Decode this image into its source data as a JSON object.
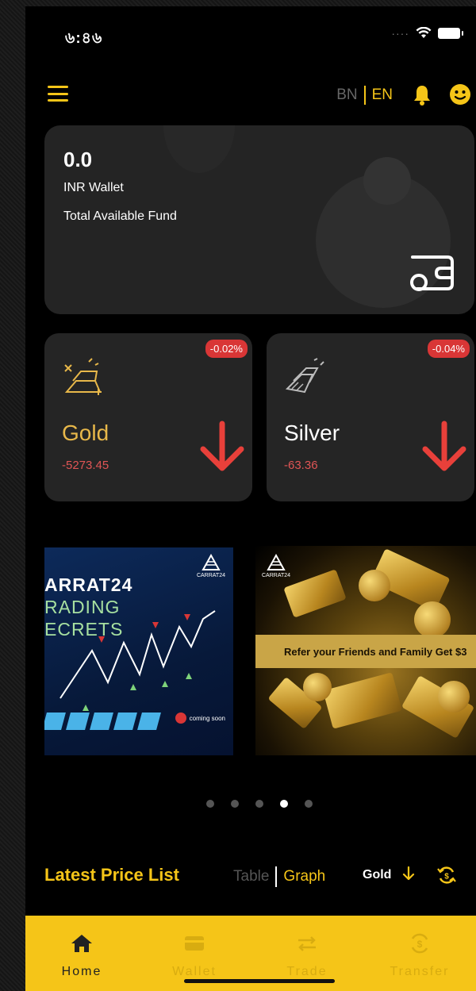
{
  "status_bar": {
    "time": "৬:৪৬"
  },
  "header": {
    "lang_bn": "BN",
    "lang_en": "EN"
  },
  "wallet": {
    "amount": "0.0",
    "currency_label": "INR Wallet",
    "fund_label": "Total Available Fund"
  },
  "metals": [
    {
      "name": "Gold",
      "change": "-5273.45",
      "percent": "-0.02%",
      "direction": "down"
    },
    {
      "name": "Silver",
      "change": "-63.36",
      "percent": "-0.04%",
      "direction": "down"
    }
  ],
  "banners": {
    "left": {
      "title": "ARRAT24",
      "line1": "RADING",
      "line2": "ECRETS",
      "logo": "CARRAT24",
      "coming": "coming soon"
    },
    "right": {
      "logo": "CARRAT24",
      "text": "Refer your Friends and Family Get $3"
    }
  },
  "carousel": {
    "count": 5,
    "active_index": 3
  },
  "price_list": {
    "title": "Latest Price List",
    "toggle_table": "Table",
    "toggle_graph": "Graph",
    "metal": "Gold"
  },
  "bottom_nav": {
    "items": [
      {
        "label": "Home",
        "icon": "home-icon",
        "active": true
      },
      {
        "label": "Wallet",
        "icon": "wallet-icon",
        "active": false
      },
      {
        "label": "Trade",
        "icon": "trade-icon",
        "active": false
      },
      {
        "label": "Transfer",
        "icon": "transfer-icon",
        "active": false
      }
    ]
  },
  "colors": {
    "accent": "#f5c518",
    "card": "#242424",
    "negative": "#d93636",
    "gold_text": "#e8b84a"
  }
}
